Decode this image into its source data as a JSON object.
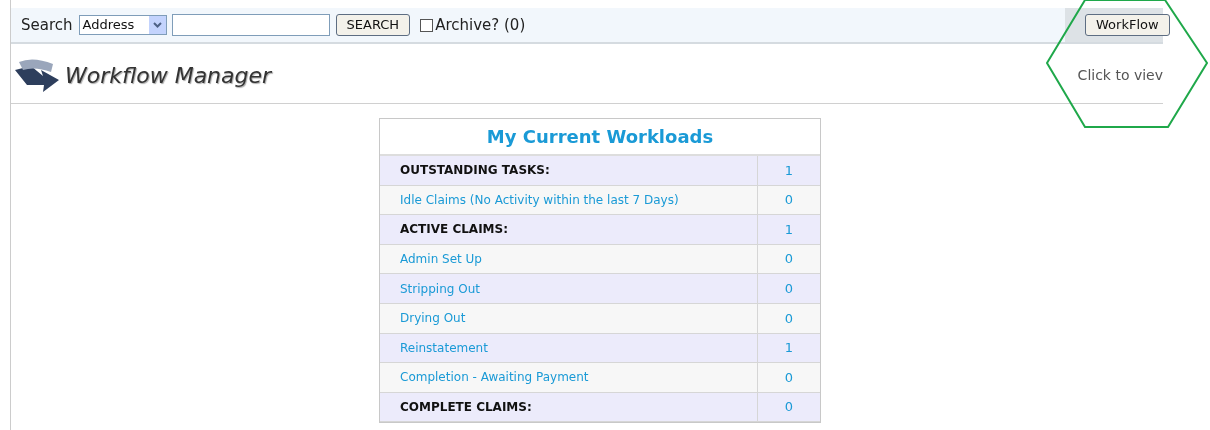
{
  "search_bar": {
    "label": "Search",
    "type_select": "Address",
    "search_button": "SEARCH",
    "archive": {
      "label": "Archive? (0)",
      "checked": false
    },
    "workflow_button": "WorkFlow"
  },
  "header": {
    "title": "Workflow Manager",
    "hint": "Click to viev"
  },
  "workloads": {
    "title": "My Current Workloads",
    "rows": [
      {
        "kind": "heading",
        "label": "OUTSTANDING TASKS:",
        "count": "1"
      },
      {
        "kind": "link",
        "label": "Idle Claims (No Activity within the last 7 Days)",
        "count": "0"
      },
      {
        "kind": "heading",
        "label": "ACTIVE CLAIMS:",
        "count": "1"
      },
      {
        "kind": "link",
        "label": "Admin Set Up",
        "count": "0"
      },
      {
        "kind": "link",
        "label": "Stripping Out",
        "count": "0"
      },
      {
        "kind": "link",
        "label": "Drying Out",
        "count": "0"
      },
      {
        "kind": "link",
        "label": "Reinstatement",
        "count": "1"
      },
      {
        "kind": "link",
        "label": "Completion - Awaiting Payment",
        "count": "0"
      },
      {
        "kind": "heading",
        "label": "COMPLETE CLAIMS:",
        "count": "0"
      }
    ]
  }
}
